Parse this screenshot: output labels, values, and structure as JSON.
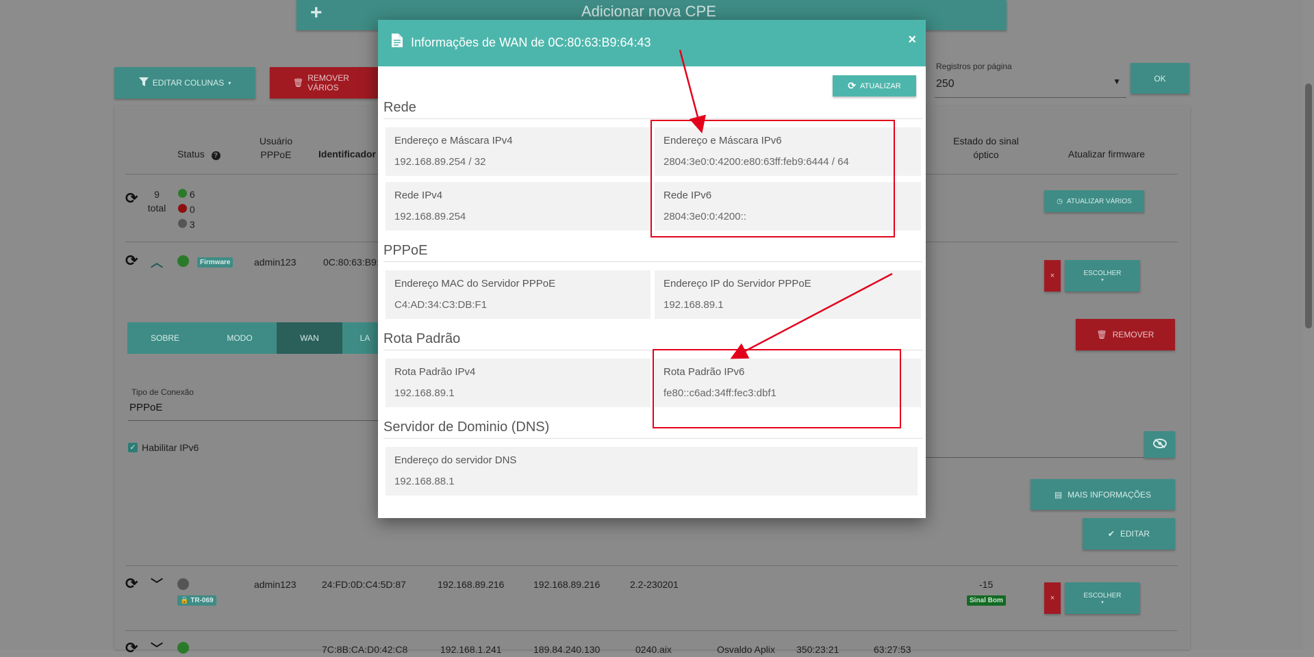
{
  "bg": {
    "add_cpe_label": "Adicionar nova CPE",
    "edit_columns_label": "EDITAR COLUNAS",
    "remove_many_label": "REMOVER VÁRIOS",
    "per_page_label": "Registros por página",
    "per_page_value": "250",
    "ok_label": "OK",
    "headers": {
      "status": "Status",
      "pppoe_user_line1": "Usuário",
      "pppoe_user_line2": "PPPoE",
      "identifier": "Identificador",
      "optical_line1": "Estado do sinal",
      "optical_line2": "óptico",
      "update_firmware": "Atualizar firmware"
    },
    "summary": {
      "total_num": "9",
      "total_label": "total",
      "green": "6",
      "red": "0",
      "gray": "3"
    },
    "update_many_label": "ATUALIZAR VÁRIOS",
    "row1": {
      "badge": "Firmware",
      "user": "admin123",
      "id": "0C:80:63:B9:",
      "choose": "ESCOLHER"
    },
    "tabs": [
      "SOBRE",
      "MODO",
      "WAN",
      "LA"
    ],
    "remove_label": "REMOVER",
    "conn_type_label": "Tipo de Conexão",
    "conn_type_value": "PPPoE",
    "enable_ipv6_label": "Habilitar IPv6",
    "more_info_label": "MAIS INFORMAÇÕES",
    "edit_label": "EDITAR",
    "row2": {
      "badge": "TR-069",
      "user": "admin123",
      "id": "24:FD:0D:C4:5D:87",
      "ip1": "192.168.89.216",
      "ip2": "192.168.89.216",
      "ver": "2.2-230201",
      "signal": "-15",
      "signal_badge": "Sinal Bom",
      "choose": "ESCOLHER"
    },
    "row3": {
      "id": "7C:8B:CA:D0:42:C8",
      "ip1": "192.168.1.241",
      "ip2": "189.84.240.130",
      "ver": "0240.aix",
      "name": "Osvaldo Aplix",
      "t1": "350:23:21",
      "t2": "63:27:53"
    }
  },
  "modal": {
    "title": "Informações de WAN de 0C:80:63:B9:64:43",
    "refresh_label": "ATUALIZAR",
    "sections": {
      "rede": "Rede",
      "pppoe": "PPPoE",
      "rota": "Rota Padrão",
      "dns": "Servidor de Dominio (DNS)"
    },
    "fields": {
      "ipv4_mask_label": "Endereço e Máscara IPv4",
      "ipv4_mask_value": "192.168.89.254 / 32",
      "ipv6_mask_label": "Endereço e Máscara IPv6",
      "ipv6_mask_value": "2804:3e0:0:4200:e80:63ff:feb9:6444 / 64",
      "net_ipv4_label": "Rede IPv4",
      "net_ipv4_value": "192.168.89.254",
      "net_ipv6_label": "Rede IPv6",
      "net_ipv6_value": "2804:3e0:0:4200::",
      "pppoe_mac_label": "Endereço MAC do Servidor PPPoE",
      "pppoe_mac_value": "C4:AD:34:C3:DB:F1",
      "pppoe_ip_label": "Endereço IP do Servidor PPPoE",
      "pppoe_ip_value": "192.168.89.1",
      "route_ipv4_label": "Rota Padrão IPv4",
      "route_ipv4_value": "192.168.89.1",
      "route_ipv6_label": "Rota Padrão IPv6",
      "route_ipv6_value": "fe80::c6ad:34ff:fec3:dbf1",
      "dns_label": "Endereço do servidor DNS",
      "dns_value": "192.168.88.1"
    }
  },
  "colors": {
    "teal": "#4db6ac",
    "annotation_red": "#e3001b"
  }
}
